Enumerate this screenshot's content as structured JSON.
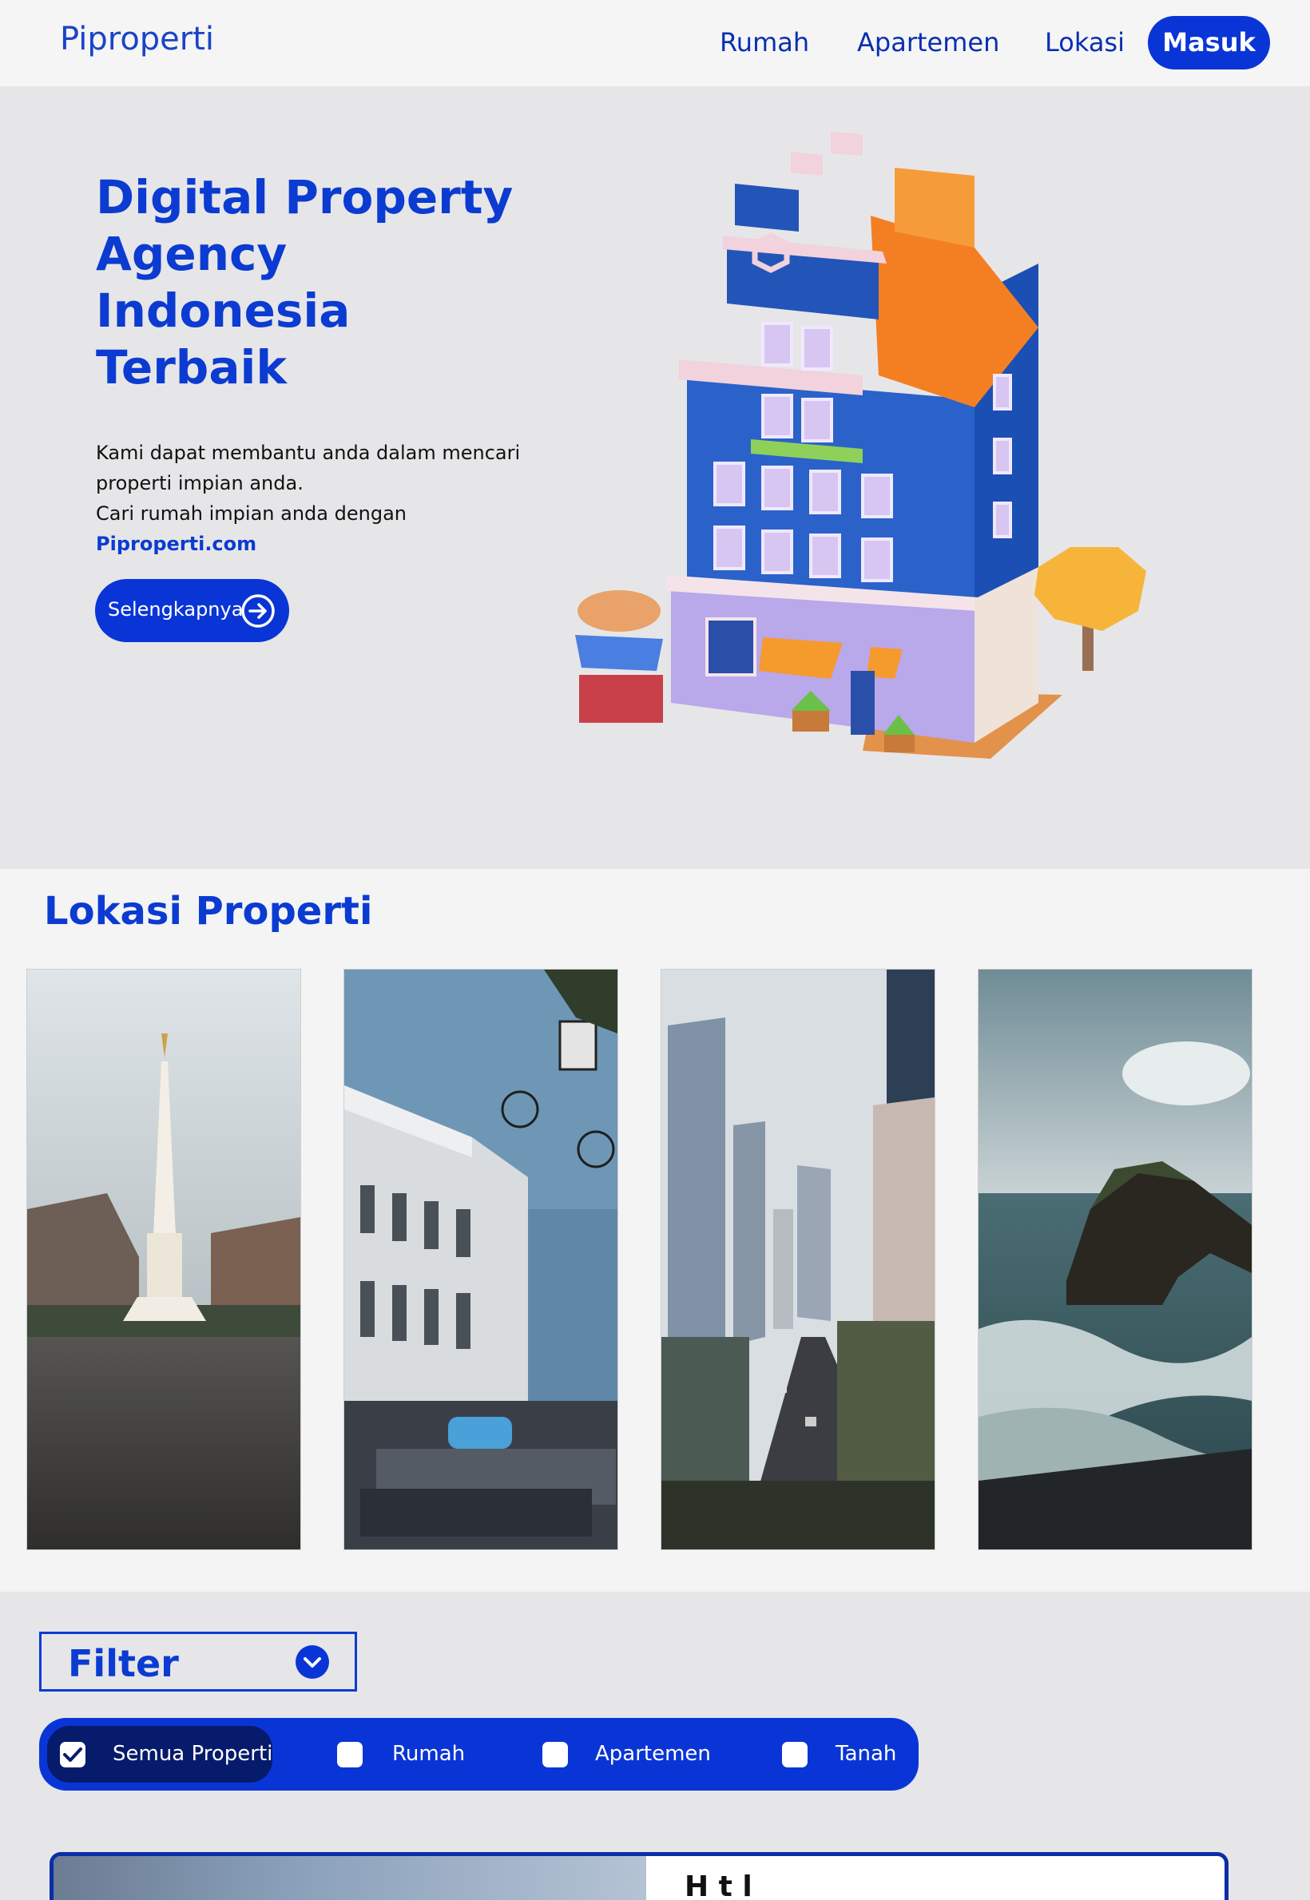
{
  "nav": {
    "brand": "Piproperti",
    "links": [
      "Rumah",
      "Apartemen",
      "Lokasi"
    ],
    "login_label": "Masuk"
  },
  "hero": {
    "title_lines": [
      "Digital Property",
      "Agency Indonesia",
      "Terbaik"
    ],
    "desc_lines": [
      "Kami dapat membantu anda dalam mencari",
      "properti impian anda.",
      "Cari rumah impian anda dengan"
    ],
    "site_link": "Piproperti.com",
    "cta_label": "Selengkapnya"
  },
  "lokasi": {
    "title": "Lokasi Properti",
    "photos": [
      "tugu-monument-photo",
      "heritage-building-photo",
      "city-skyscrapers-photo",
      "coastal-rock-temple-photo"
    ]
  },
  "filter": {
    "label": "Filter",
    "options": [
      {
        "label": "Semua Properti",
        "checked": true
      },
      {
        "label": "Rumah",
        "checked": false
      },
      {
        "label": "Apartemen",
        "checked": false
      },
      {
        "label": "Tanah",
        "checked": false
      }
    ]
  },
  "listing": {
    "title_partial": "H    t    l    "
  },
  "colors": {
    "primary": "#0a35d6",
    "primary_dark": "#061b6b",
    "heading_blue": "#0b3bd1",
    "page_bg": "#e6e6e8"
  }
}
